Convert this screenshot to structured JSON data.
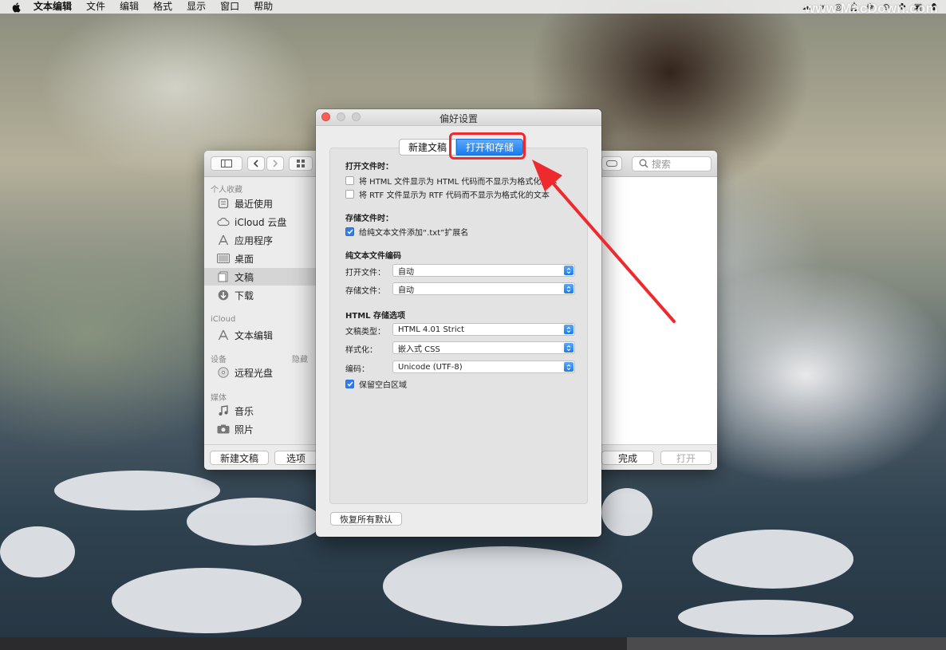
{
  "menubar": {
    "app_name": "文本编辑",
    "items": [
      "文件",
      "编辑",
      "格式",
      "显示",
      "窗口",
      "帮助"
    ],
    "watermark": "www.MacDown.com",
    "status_icons": [
      "cloud-icon",
      "vector-icon",
      "chat-bubble-icon",
      "bell-icon",
      "wechat-icon",
      "circles-icon",
      "puzzle-icon",
      "camera-icon",
      "shield-icon"
    ]
  },
  "finder": {
    "search_placeholder": "搜索",
    "sidebar": {
      "personal_header": "个人收藏",
      "personal_items": [
        {
          "label": "最近使用",
          "icon": "recent-icon"
        },
        {
          "label": "iCloud 云盘",
          "icon": "cloud-icon"
        },
        {
          "label": "应用程序",
          "icon": "apps-icon"
        },
        {
          "label": "桌面",
          "icon": "desktop-icon"
        },
        {
          "label": "文稿",
          "icon": "documents-icon",
          "selected": true
        },
        {
          "label": "下载",
          "icon": "download-icon"
        }
      ],
      "icloud_header": "iCloud",
      "icloud_items": [
        {
          "label": "文本编辑",
          "icon": "textedit-icon"
        }
      ],
      "devices_header": "设备",
      "devices_hide": "隐藏",
      "devices_items": [
        {
          "label": "远程光盘",
          "icon": "disc-icon"
        }
      ],
      "media_header": "媒体",
      "media_items": [
        {
          "label": "音乐",
          "icon": "music-icon"
        },
        {
          "label": "照片",
          "icon": "photo-icon"
        }
      ]
    },
    "bottom": {
      "new_doc": "新建文稿",
      "options": "选项",
      "done": "完成",
      "open": "打开"
    }
  },
  "prefs": {
    "title": "偏好设置",
    "tabs": [
      {
        "label": "新建文稿",
        "active": false
      },
      {
        "label": "打开和存储",
        "active": true
      }
    ],
    "open_section": {
      "title": "打开文件时：",
      "options": [
        {
          "label": "将 HTML 文件显示为 HTML 代码而不显示为格式化文本",
          "checked": false
        },
        {
          "label": "将 RTF 文件显示为 RTF 代码而不显示为格式化的文本",
          "checked": false
        }
      ]
    },
    "save_section": {
      "title": "存储文件时：",
      "options": [
        {
          "label": "给纯文本文件添加“.txt”扩展名",
          "checked": true
        }
      ]
    },
    "encoding_section": {
      "title": "纯文本文件编码",
      "open_label": "打开文件：",
      "open_value": "自动",
      "save_label": "存储文件：",
      "save_value": "自动"
    },
    "html_section": {
      "title": "HTML 存储选项",
      "doctype_label": "文稿类型：",
      "doctype_value": "HTML 4.01 Strict",
      "styling_label": "样式化：",
      "styling_value": "嵌入式 CSS",
      "encoding_label": "编码：",
      "encoding_value": "Unicode (UTF-8)",
      "preserve_label": "保留空白区域",
      "preserve_checked": true
    },
    "restore_button": "恢复所有默认"
  },
  "colors": {
    "accent_blue": "#1a7cf0",
    "annotation_red": "#ee2a2f",
    "close_red": "#fc5f57"
  }
}
